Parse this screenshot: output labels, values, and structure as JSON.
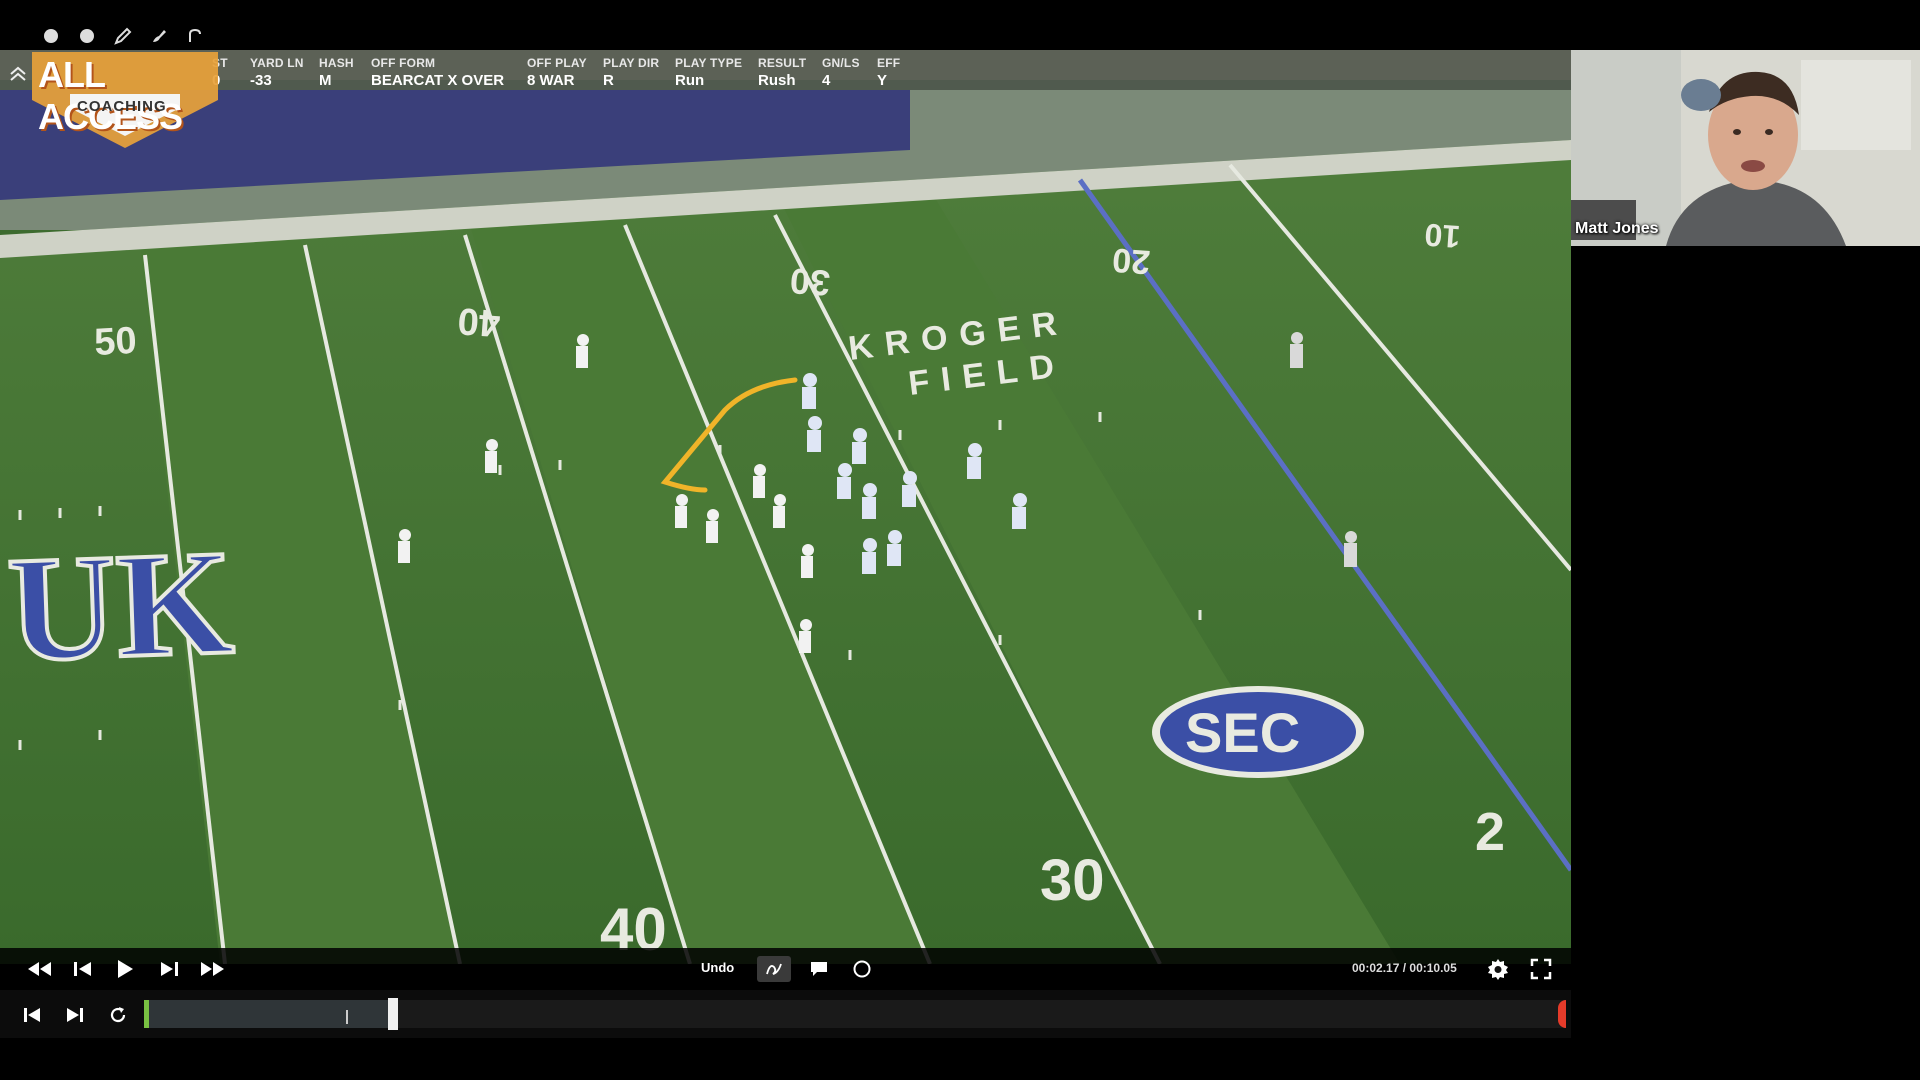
{
  "tool_icons": [
    "circle-dot-icon",
    "circle-dot-icon",
    "pencil-icon",
    "brush-icon",
    "hook-icon"
  ],
  "logo": {
    "main": "ALL ACCESS",
    "sub": "COACHING"
  },
  "play_info": [
    {
      "header": "ST",
      "value": "0"
    },
    {
      "header": "YARD LN",
      "value": "-33"
    },
    {
      "header": "HASH",
      "value": "M"
    },
    {
      "header": "OFF FORM",
      "value": "BEARCAT X OVER"
    },
    {
      "header": "OFF PLAY",
      "value": "8 WAR"
    },
    {
      "header": "PLAY DIR",
      "value": "R"
    },
    {
      "header": "PLAY TYPE",
      "value": "Run"
    },
    {
      "header": "RESULT",
      "value": "Rush"
    },
    {
      "header": "GN/LS",
      "value": "4"
    },
    {
      "header": "EFF",
      "value": "Y"
    }
  ],
  "field_text": {
    "yard_50": "50",
    "yard_40_left": "40",
    "yard_30_top": "30",
    "yard_20_top": "20",
    "yard_10_top": "10",
    "stadium_line1": "KROGER",
    "stadium_line2": "FIELD",
    "logo_uk": "UK",
    "logo_sec": "SEC",
    "yard_40_bottom": "40",
    "yard_30_bottom": "30",
    "yard_20_bottom": "2"
  },
  "controls": {
    "undo_label": "Undo",
    "current_time": "00:02.17",
    "separator": " / ",
    "total_time": "00:10.05"
  },
  "timeline": {
    "progress": 0.175,
    "marker": 0.142
  },
  "webcam": {
    "name": "Matt Jones"
  },
  "colors": {
    "accent_orange": "#e8a23a",
    "drawing_yellow": "#f0b429",
    "track_green": "#79c142",
    "track_red": "#e53b2a"
  }
}
